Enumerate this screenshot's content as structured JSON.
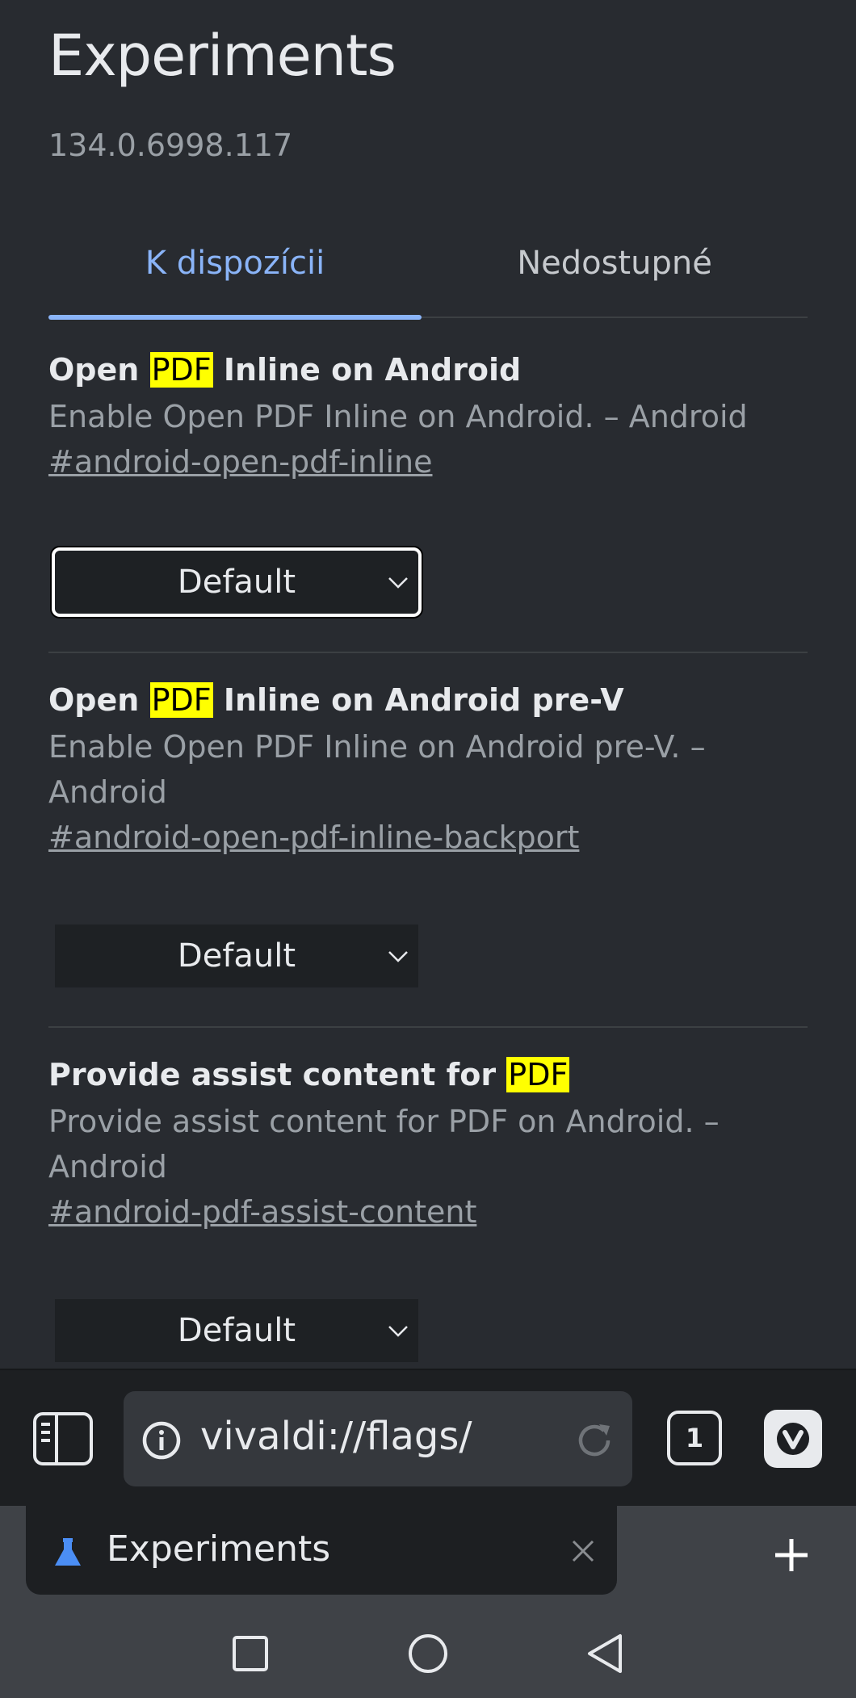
{
  "page": {
    "title": "Experiments",
    "version": "134.0.6998.117",
    "tabs": [
      {
        "label": "K dispozícii",
        "active": true
      },
      {
        "label": "Nedostupné",
        "active": false
      }
    ]
  },
  "experiments": [
    {
      "title_prefix": "Open ",
      "highlight": "PDF",
      "title_suffix": " Inline on Android",
      "description": "Enable Open PDF Inline on Android. – Android",
      "link": "#android-open-pdf-inline",
      "select_value": "Default"
    },
    {
      "title_prefix": "Open ",
      "highlight": "PDF",
      "title_suffix": " Inline on Android pre-V",
      "description": "Enable Open PDF Inline on Android pre-V. – Android",
      "link": "#android-open-pdf-inline-backport",
      "select_value": "Default"
    },
    {
      "title_prefix": "Provide assist content for ",
      "highlight": "PDF",
      "title_suffix": "",
      "description": "Provide assist content for PDF on Android. – Android",
      "link": "#android-pdf-assist-content",
      "select_value": "Default"
    }
  ],
  "toolbar": {
    "url": "vivaldi://flags/",
    "tab_count": "1"
  },
  "tabbar": {
    "tab_title": "Experiments"
  },
  "icons": {
    "panel": "panel-toggle-icon",
    "info": "info-icon",
    "reload": "reload-icon",
    "vivaldi": "vivaldi-menu-icon",
    "flask": "flask-icon",
    "close": "close-icon",
    "add": "plus-icon",
    "nav": [
      "recents-square-icon",
      "home-circle-icon",
      "back-triangle-icon"
    ]
  },
  "colors": {
    "background": "#282b30",
    "accent": "#8ab4f8",
    "highlight": "#ffff00",
    "toolbar": "#1d1f22"
  }
}
